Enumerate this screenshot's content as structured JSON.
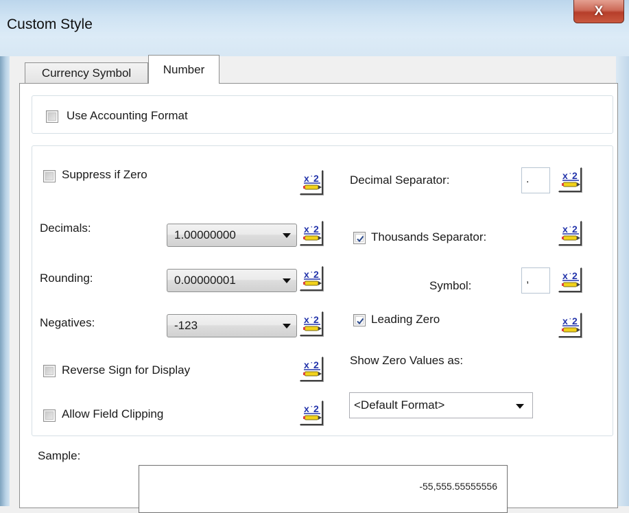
{
  "window": {
    "title": "Custom Style",
    "close_label": "X"
  },
  "tabs": [
    {
      "label": "Currency Symbol",
      "active": false
    },
    {
      "label": "Number",
      "active": true
    }
  ],
  "accounting": {
    "label": "Use Accounting Format",
    "checked": false
  },
  "left": {
    "suppress_zero": {
      "label": "Suppress if Zero",
      "checked": false
    },
    "decimals": {
      "label": "Decimals:",
      "value": "1.00000000"
    },
    "rounding": {
      "label": "Rounding:",
      "value": "0.00000001"
    },
    "negatives": {
      "label": "Negatives:",
      "value": "-123"
    },
    "reverse_sign": {
      "label": "Reverse Sign for Display",
      "checked": false
    },
    "allow_clipping": {
      "label": "Allow Field Clipping",
      "checked": false
    }
  },
  "right": {
    "decimal_separator": {
      "label": "Decimal Separator:",
      "value": "."
    },
    "thousands_separator": {
      "label": "Thousands Separator:",
      "checked": true
    },
    "symbol": {
      "label": "Symbol:",
      "value": ","
    },
    "leading_zero": {
      "label": "Leading Zero",
      "checked": true
    },
    "show_zero": {
      "label": "Show Zero Values as:",
      "value": "<Default Format>"
    }
  },
  "sample": {
    "label": "Sample:",
    "value": "-55,555.55555556"
  },
  "formula_button": {
    "text_top": "x",
    "text_sup": "2"
  },
  "colors": {
    "formula_blue": "#2233aa",
    "formula_yellow": "#f2d21b",
    "check_blue": "#2b4a8c"
  }
}
